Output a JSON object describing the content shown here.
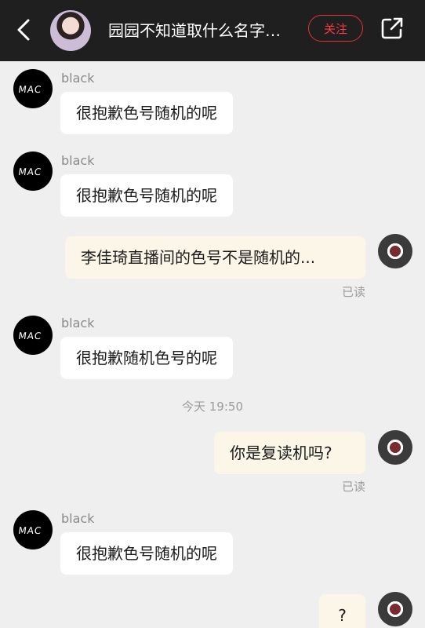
{
  "header": {
    "title": "园园不知道取什么名字…",
    "follow_label": "关注",
    "back_icon": "chevron-left-icon",
    "share_icon": "share-icon"
  },
  "messages": [
    {
      "sender": "black",
      "text": "很抱歉色号随机的呢"
    },
    {
      "sender": "black",
      "text": "很抱歉色号随机的呢"
    },
    {
      "text": "李佳琦直播间的色号不是随机的...",
      "status": "已读"
    },
    {
      "sender": "black",
      "text": "很抱歉随机色号的呢"
    },
    {
      "timestamp": "今天 19:50"
    },
    {
      "text": "你是复读机吗?",
      "status": "已读"
    },
    {
      "sender": "black",
      "text": "很抱歉色号随机的呢"
    },
    {
      "text": "?"
    }
  ],
  "colors": {
    "header_bg": "#1f1f1f",
    "chat_bg": "#efefef",
    "follow_accent": "#e0323a",
    "incoming_bubble": "#ffffff",
    "outgoing_bubble": "#fbf6e8"
  }
}
